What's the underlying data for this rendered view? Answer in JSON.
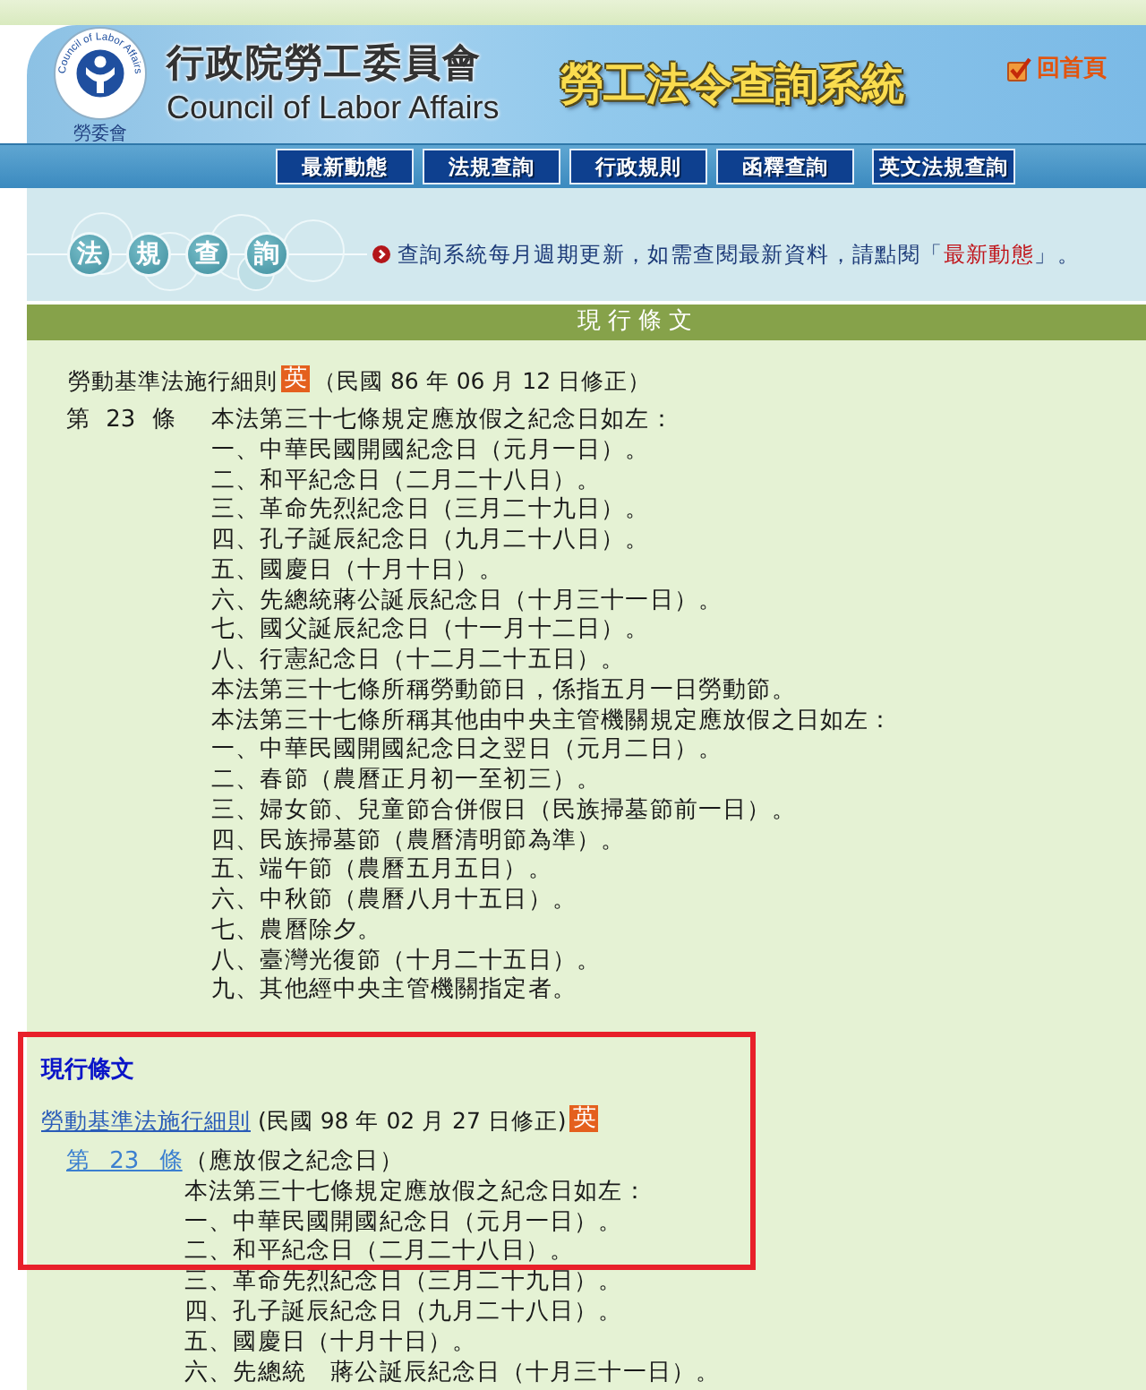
{
  "header": {
    "logo_arc_text": "Council of Labor Affairs",
    "logo_caption": "勞委會",
    "org_name": "行政院勞工委員會",
    "org_name_en": "Council of Labor Affairs",
    "system_title": "勞工法令查詢系統",
    "home_link": "回首頁"
  },
  "nav": [
    "最新動態",
    "法規查詢",
    "行政規則",
    "函釋查詢",
    "英文法規查詢"
  ],
  "banner": {
    "heading_chars": [
      "法",
      "規",
      "查",
      "詢"
    ],
    "notice": {
      "text": "查詢系統每月週期更新，如需查閱最新資料，請點閱「",
      "link": "最新動態",
      "after": "」。"
    }
  },
  "section_bar": {
    "title": "現行條文"
  },
  "regulations": [
    {
      "kind": "plain",
      "highlighted": false,
      "title_parts": [
        {
          "kind": "title",
          "text": "勞動基準法施行細則"
        },
        {
          "kind": "badge",
          "text": "英"
        },
        {
          "kind": "amendment",
          "text": "（民國 86 年 06 月 12 日修正）"
        }
      ],
      "articles": [
        {
          "number": "第 23 條",
          "lines": [
            "本法第三十七條規定應放假之紀念日如左：",
            "一、中華民國開國紀念日（元月一日）。",
            "二、和平紀念日（二月二十八日）。",
            "三、革命先烈紀念日（三月二十九日）。",
            "四、孔子誕辰紀念日（九月二十八日）。",
            "五、國慶日（十月十日）。",
            "六、先總統蔣公誕辰紀念日（十月三十一日）。",
            "七、國父誕辰紀念日（十一月十二日）。",
            "八、行憲紀念日（十二月二十五日）。",
            "本法第三十七條所稱勞動節日，係指五月一日勞動節。",
            "本法第三十七條所稱其他由中央主管機關規定應放假之日如左：",
            "一、中華民國開國紀念日之翌日（元月二日）。",
            "二、春節（農曆正月初一至初三）。",
            "三、婦女節、兒童節合併假日（民族掃墓節前一日）。",
            "四、民族掃墓節（農曆清明節為準）。",
            "五、端午節（農曆五月五日）。",
            "六、中秋節（農曆八月十五日）。",
            "七、農曆除夕。",
            "八、臺灣光復節（十月二十五日）。",
            "九、其他經中央主管機關指定者。"
          ]
        }
      ]
    },
    {
      "kind": "linked",
      "highlighted": true,
      "heading": "現行條文",
      "title_parts": [
        {
          "kind": "title",
          "text": "勞動基準法施行細則"
        },
        {
          "kind": "amendment",
          "text": "(民國 98 年 02 月 27 日修正)"
        },
        {
          "kind": "badge",
          "text": "英"
        }
      ],
      "articles": [
        {
          "number": "第 23 條",
          "lines": [
            "（應放假之紀念日）",
            "本法第三十七條規定應放假之紀念日如左：",
            "一、中華民國開國紀念日（元月一日）。",
            "二、和平紀念日（二月二十八日）。",
            "三、革命先烈紀念日（三月二十九日）。",
            "四、孔子誕辰紀念日（九月二十八日）。",
            "五、國慶日（十月十日）。",
            "六、先總統　蔣公誕辰紀念日（十月三十一日）。"
          ]
        }
      ]
    }
  ]
}
